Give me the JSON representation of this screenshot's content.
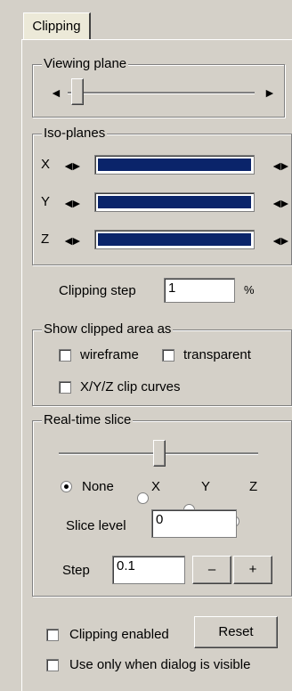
{
  "tab": {
    "label": "Clipping"
  },
  "viewing_plane": {
    "legend": "Viewing plane",
    "left_arrow": "◄",
    "right_arrow": "►",
    "slider_value": 0.1
  },
  "iso_planes": {
    "legend": "Iso-planes",
    "rows": [
      {
        "axis": "X",
        "left_arrows": "◄►",
        "right_arrows": "◄►"
      },
      {
        "axis": "Y",
        "left_arrows": "◄►",
        "right_arrows": "◄►"
      },
      {
        "axis": "Z",
        "left_arrows": "◄►",
        "right_arrows": "◄►"
      }
    ]
  },
  "clipping_step": {
    "label": "Clipping step",
    "value": "1",
    "unit": "%"
  },
  "show_clipped": {
    "legend": "Show clipped area as",
    "wireframe": "wireframe",
    "transparent": "transparent",
    "clip_curves": "X/Y/Z clip curves"
  },
  "realtime_slice": {
    "legend": "Real-time slice",
    "slider_value": 0.5,
    "radios": [
      "None",
      "X",
      "Y",
      "Z"
    ],
    "selected": "None",
    "slice_level_label": "Slice level",
    "slice_level_value": "0",
    "step_label": "Step",
    "step_value": "0.1",
    "minus": "–",
    "plus": "+"
  },
  "bottom": {
    "clipping_enabled": "Clipping enabled",
    "reset": "Reset",
    "use_only": "Use only when dialog is visible"
  },
  "colors": {
    "bar": "#0a246a",
    "background": "#d4d0c8"
  }
}
